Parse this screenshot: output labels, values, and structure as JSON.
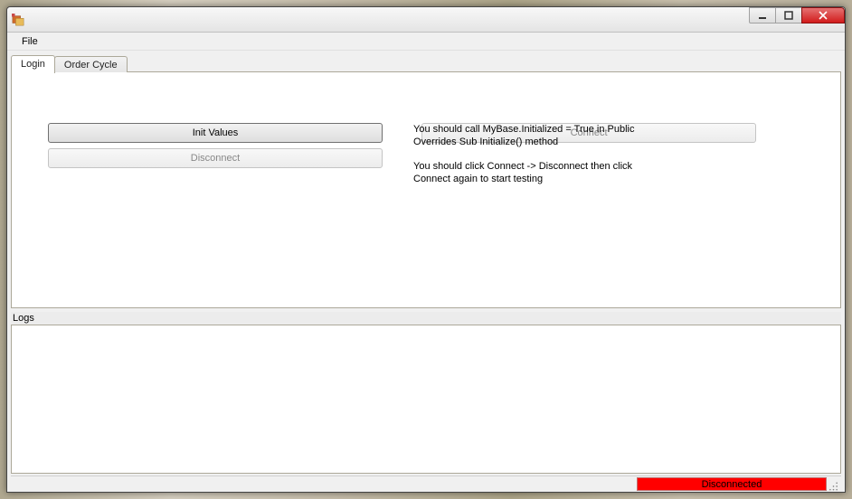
{
  "window": {
    "title": ""
  },
  "menubar": {
    "file": "File"
  },
  "tabs": {
    "login": "Login",
    "order_cycle": "Order Cycle"
  },
  "login_tab": {
    "buttons": {
      "init_values": "Init Values",
      "connect": "Connect",
      "disconnect": "Disconnect"
    },
    "instructions": {
      "line1": "You should call MyBase.Initialized = True in Public Overrides Sub Initialize() method",
      "line2": "You should click Connect -> Disconnect then click Connect again to start testing"
    }
  },
  "logs": {
    "label": "Logs",
    "content": ""
  },
  "statusbar": {
    "connection": "Disconnected",
    "connection_color": "#ff0000"
  }
}
